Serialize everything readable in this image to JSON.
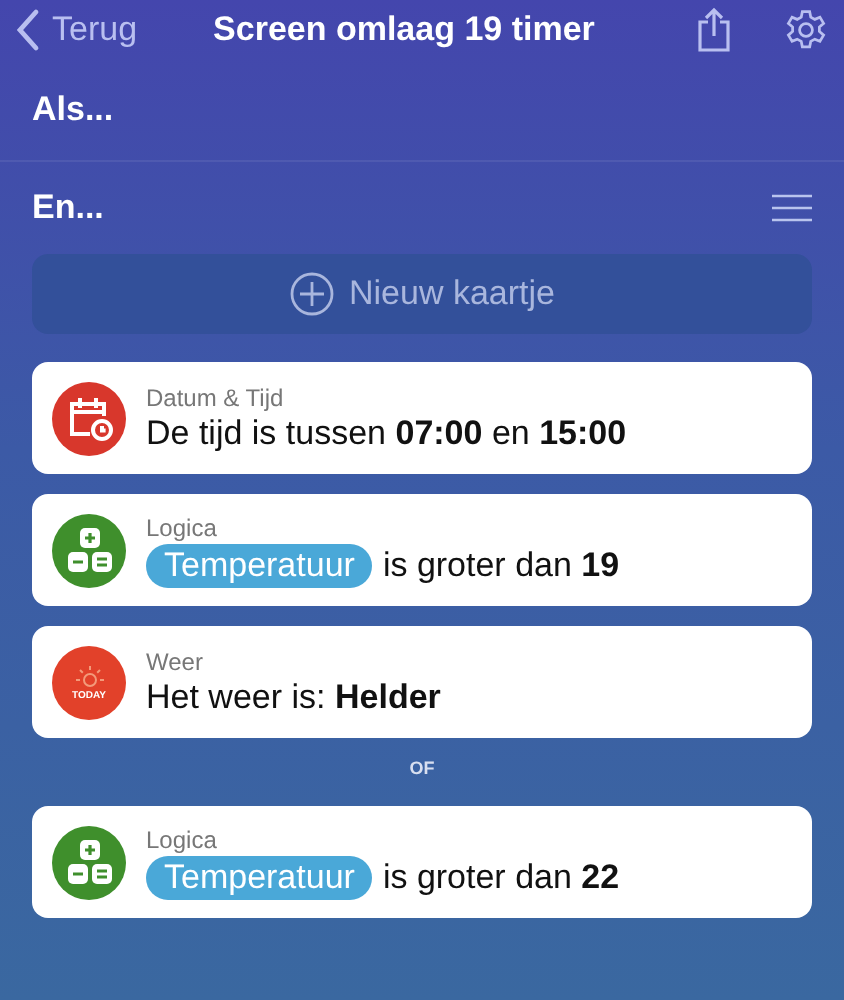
{
  "nav": {
    "back": "Terug",
    "title": "Screen omlaag 19 timer"
  },
  "sections": [
    {
      "label": "Als..."
    },
    {
      "label": "En...",
      "menu": true
    }
  ],
  "new_card": {
    "label": "Nieuw kaartje"
  },
  "conditions": [
    {
      "kind": "date",
      "category": "Datum & Tijd",
      "text": "De tijd is tussen **07:00** en **15:00**"
    },
    {
      "kind": "logic",
      "category": "Logica",
      "token": "Temperatuur",
      "text": "is groter dan **19**"
    },
    {
      "kind": "weather",
      "category": "Weer",
      "icon_text": "TODAY",
      "text": "Het weer is: **Helder**"
    },
    {
      "kind": "divider",
      "text": "OF"
    },
    {
      "kind": "logic",
      "category": "Logica",
      "token": "Temperatuur",
      "text": "is groter dan **22**"
    }
  ]
}
